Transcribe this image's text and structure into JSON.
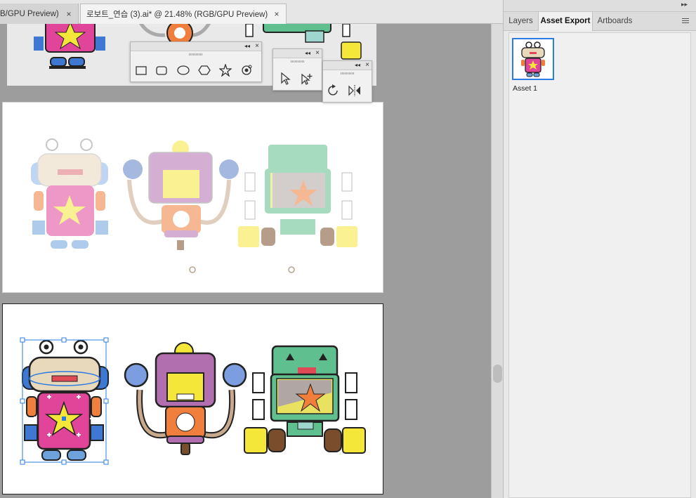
{
  "document_tabs": [
    {
      "label": "B/GPU Preview)",
      "close": "×"
    },
    {
      "label": "로보트_연습 (3).ai* @ 21.48% (RGB/GPU Preview)",
      "close": "×"
    }
  ],
  "panel": {
    "collapse_glyph": "▸▸",
    "tabs": [
      "Layers",
      "Asset Export",
      "Artboards"
    ],
    "active_tab": "Asset Export",
    "assets": [
      {
        "label": "Asset 1"
      }
    ]
  },
  "floating_panels": {
    "header_glyphs": {
      "collapse": "◂◂",
      "close": "×"
    },
    "shape_tools": [
      "rectangle-tool-icon",
      "rounded-rectangle-tool-icon",
      "ellipse-tool-icon",
      "polygon-tool-icon",
      "star-tool-icon",
      "flare-tool-icon"
    ],
    "selection_tools": [
      "selection-tool-icon",
      "add-anchor-point-tool-icon"
    ],
    "transform_tools": [
      "rotate-tool-icon",
      "reflect-tool-icon"
    ]
  },
  "colors": {
    "selection_blue": "#2a7be4",
    "robot_pink": "#e0459a",
    "robot_purple": "#b26fb0",
    "robot_green": "#5fbf8e",
    "robot_yellow": "#f5e63a"
  }
}
